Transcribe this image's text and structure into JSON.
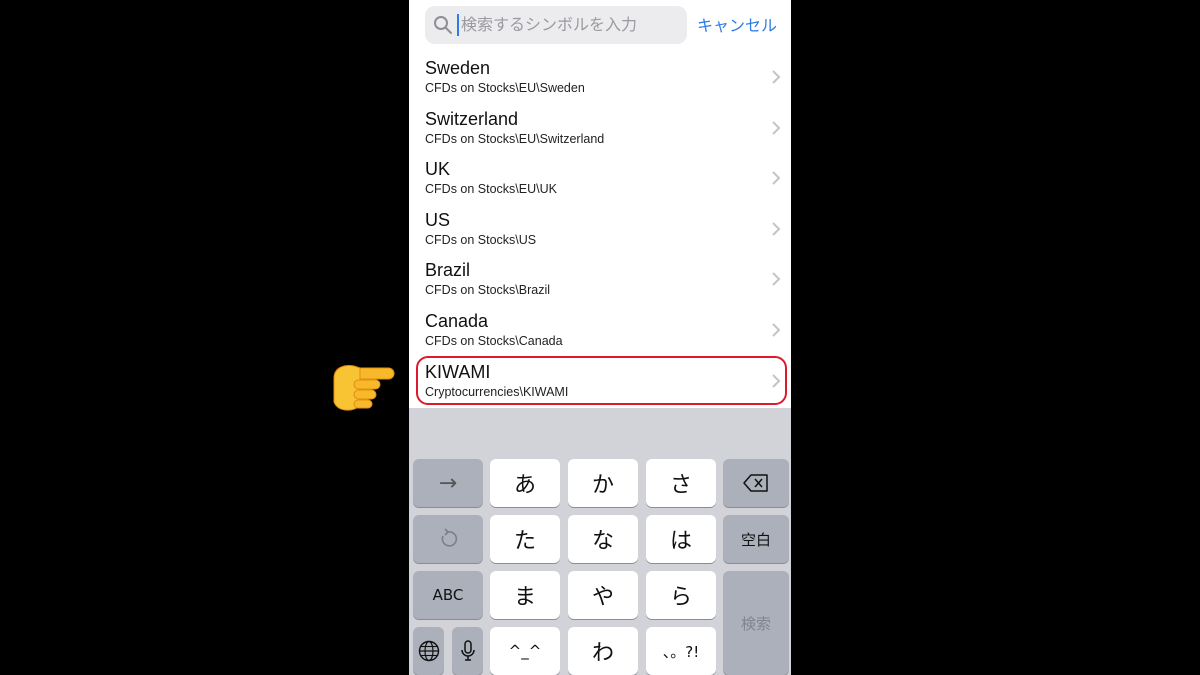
{
  "search": {
    "placeholder": "検索するシンボルを入力",
    "cancel_label": "キャンセル"
  },
  "list": [
    {
      "title": "Sweden",
      "path": "CFDs on Stocks\\EU\\Sweden"
    },
    {
      "title": "Switzerland",
      "path": "CFDs on Stocks\\EU\\Switzerland"
    },
    {
      "title": "UK",
      "path": "CFDs on Stocks\\EU\\UK"
    },
    {
      "title": "US",
      "path": "CFDs on Stocks\\US"
    },
    {
      "title": "Brazil",
      "path": "CFDs on Stocks\\Brazil"
    },
    {
      "title": "Canada",
      "path": "CFDs on Stocks\\Canada"
    },
    {
      "title": "KIWAMI",
      "path": "Cryptocurrencies\\KIWAMI",
      "highlighted": true
    }
  ],
  "keyboard": {
    "next_key": "→",
    "undo_key": "undo-icon",
    "abc_key": "ABC",
    "globe_key": "globe-icon",
    "mic_key": "microphone-icon",
    "row1": [
      "あ",
      "か",
      "さ"
    ],
    "row2": [
      "た",
      "な",
      "は"
    ],
    "row3": [
      "ま",
      "や",
      "ら"
    ],
    "row4": [
      "^_^",
      "わ",
      "、。?!"
    ],
    "delete_key": "delete-icon",
    "space_label": "空白",
    "search_label": "検索"
  },
  "colors": {
    "accent": "#2f7be7",
    "highlight": "#e0182c",
    "keyboard_bg": "#d1d3d9"
  }
}
